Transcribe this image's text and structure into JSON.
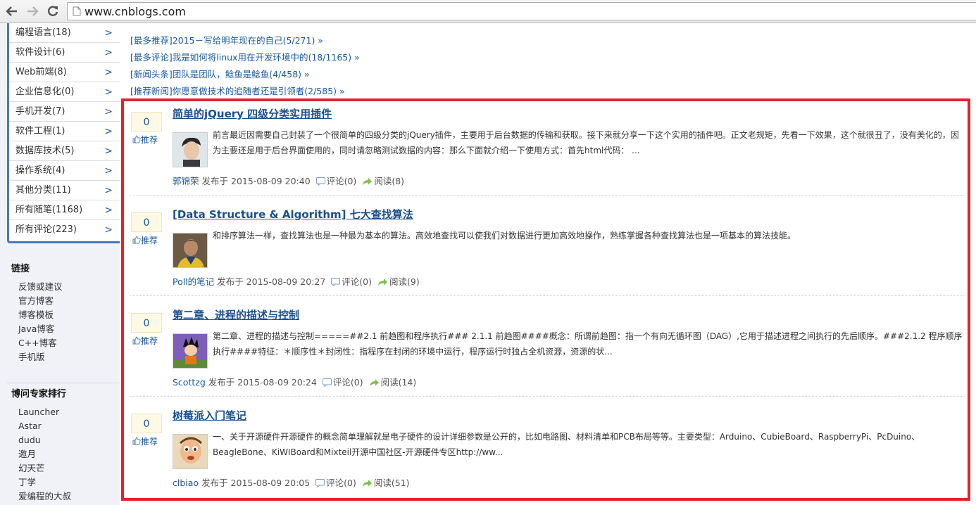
{
  "browser": {
    "url": "www.cnblogs.com"
  },
  "categories": [
    "编程语言(18)",
    "软件设计(6)",
    "Web前端(8)",
    "企业信息化(0)",
    "手机开发(7)",
    "软件工程(1)",
    "数据库技术(5)",
    "操作系统(4)",
    "其他分类(11)",
    "所有随笔(1168)",
    "所有评论(223)"
  ],
  "links": {
    "title": "链接",
    "items": [
      "反馈或建议",
      "官方博客",
      "博客模板",
      "Java博客",
      "C++博客",
      "手机版"
    ]
  },
  "experts": {
    "title": "博问专家排行",
    "items": [
      "Launcher",
      "Astar",
      "dudu",
      "邀月",
      "幻天芒",
      "丁学",
      "爱编程的大叔"
    ]
  },
  "notices": [
    "[最多推荐]2015－写给明年现在的自己(5/271) »",
    "[最多评论]我是如何将linux用在开发环境中的(18/1165) »",
    "[新闻头条]团队是团队，鲶鱼是鲶鱼(4/458) »",
    "[推荐新闻]你愿意做技术的追随者还是引领者(2/585) »"
  ],
  "labels": {
    "published": "发布于",
    "recommend": "推荐"
  },
  "posts": [
    {
      "digg": "0",
      "title": "简单的jQuery 四级分类实用插件",
      "summary": "前言最近因需要自己封装了一个很简单的四级分类的jQuery插件，主要用于后台数据的传输和获取。接下来就分享一下这个实用的插件吧。正文老规矩，先看一下效果，这个就很丑了，没有美化的，因为主要还是用于后台界面使用的，同时请忽略测试数据的内容：那么下面就介绍一下使用方式：首先html代码：  ...",
      "author": "郭锦荣",
      "date": "2015-08-09 20:40",
      "comments": "评论(0)",
      "reads": "阅读(8)"
    },
    {
      "digg": "0",
      "title": "[Data Structure & Algorithm] 七大查找算法",
      "summary": "和排序算法一样，查找算法也是一种最为基本的算法。高效地查找可以使我们对数据进行更加高效地操作，熟练掌握各种查找算法也是一项基本的算法技能。",
      "author": "Poll的笔记",
      "date": "2015-08-09 20:27",
      "comments": "评论(0)",
      "reads": "阅读(9)"
    },
    {
      "digg": "0",
      "title": "第二章、进程的描述与控制",
      "summary": "第二章、进程的描述与控制=====##2.1 前趋图和程序执行### 2.1.1 前趋图####概念：所谓前趋图：指一个有向无循环图（DAG）,它用于描述进程之间执行的先后顺序。###2.1.2 程序顺序执行####特征：＊顺序性＊封闭性：指程序在封闭的环境中运行，程序运行时独占全机资源，资源的状...",
      "author": "Scottzg",
      "date": "2015-08-09 20:24",
      "comments": "评论(0)",
      "reads": "阅读(14)"
    },
    {
      "digg": "0",
      "title": "树莓派入门笔记",
      "summary": "一、关于开源硬件开源硬件的概念简单理解就是电子硬件的设计详细参数是公开的，比如电路图、材料清单和PCB布局等等。主要类型：Arduino、CubieBoard、RaspberryPi、PcDuino、BeagleBone、KiWIBoard和Mixteil开源中国社区-开源硬件专区http://ww...",
      "author": "clbiao",
      "date": "2015-08-09 20:05",
      "comments": "评论(0)",
      "reads": "阅读(51)"
    }
  ]
}
